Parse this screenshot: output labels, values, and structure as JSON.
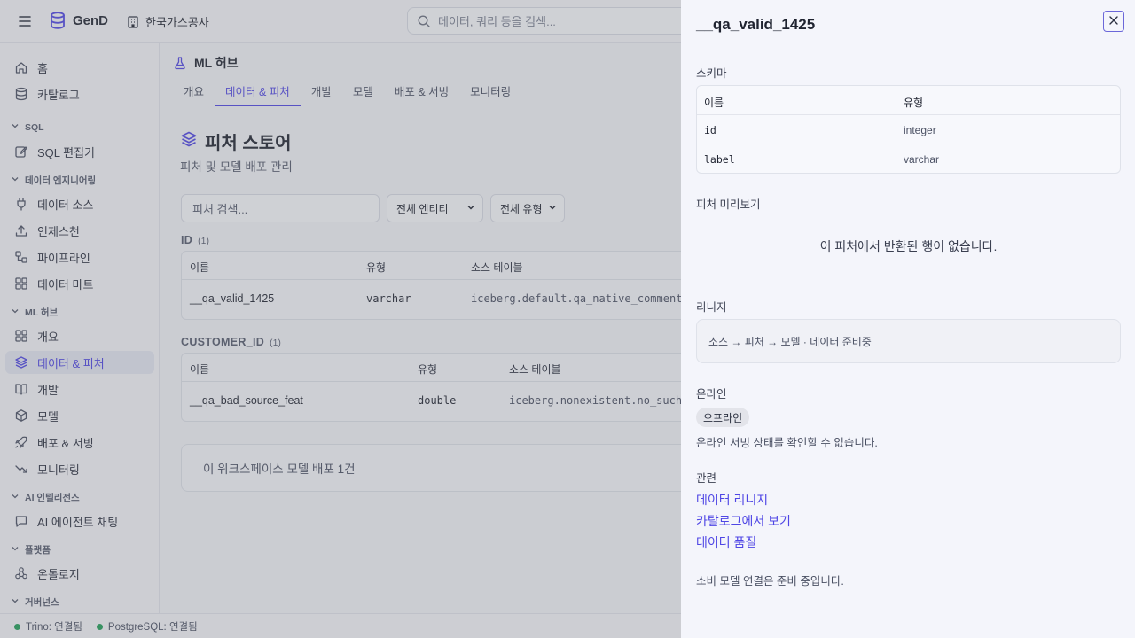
{
  "topbar": {
    "brand": "GenD",
    "org": "한국가스공사",
    "search_placeholder": "데이터, 쿼리 등을 검색..."
  },
  "sidebar": {
    "items_top": [
      {
        "label": "홈",
        "icon": "home-icon"
      },
      {
        "label": "카탈로그",
        "icon": "database-icon"
      }
    ],
    "sections": {
      "sql": "SQL",
      "data_eng": "데이터 엔지니어링",
      "ml_hub": "ML 허브",
      "ai": "AI 인텔리전스",
      "platform": "플랫폼",
      "governance": "거버넌스"
    },
    "sql_items": [
      {
        "label": "SQL 편집기",
        "icon": "edit-icon"
      }
    ],
    "de_items": [
      {
        "label": "데이터 소스",
        "icon": "plug-icon"
      },
      {
        "label": "인제스천",
        "icon": "upload-icon"
      },
      {
        "label": "파이프라인",
        "icon": "pipeline-icon"
      },
      {
        "label": "데이터 마트",
        "icon": "grid-icon"
      }
    ],
    "ml_items": [
      {
        "label": "개요",
        "icon": "grid-icon"
      },
      {
        "label": "데이터 & 피처",
        "icon": "layers-icon",
        "active": true
      },
      {
        "label": "개발",
        "icon": "book-icon"
      },
      {
        "label": "모델",
        "icon": "cube-icon"
      },
      {
        "label": "배포 & 서빙",
        "icon": "rocket-icon"
      },
      {
        "label": "모니터링",
        "icon": "trend-icon"
      }
    ],
    "ai_items": [
      {
        "label": "AI 에이전트 채팅",
        "icon": "chat-icon"
      }
    ],
    "platform_items": [
      {
        "label": "온톨로지",
        "icon": "network-icon"
      }
    ]
  },
  "statusbar": {
    "trino": "Trino: 연결됨",
    "postgres": "PostgreSQL: 연결됨"
  },
  "main": {
    "hub_title": "ML 허브",
    "tabs": [
      "개요",
      "데이터 & 피처",
      "개발",
      "모델",
      "배포 & 서빙",
      "모니터링"
    ],
    "active_tab": 1,
    "page_title": "피처 스토어",
    "page_subtitle": "피처 및 모델 배포 관리",
    "feature_search_placeholder": "피처 검색...",
    "entity_filter": "전체 엔티티",
    "type_filter": "전체 유형",
    "groups": [
      {
        "name": "ID",
        "count": "(1)",
        "headers": [
          "이름",
          "유형",
          "소스 테이블"
        ],
        "rows": [
          [
            "__qa_valid_1425",
            "varchar",
            "iceberg.default.qa_native_comment"
          ]
        ]
      },
      {
        "name": "CUSTOMER_ID",
        "count": "(1)",
        "headers": [
          "이름",
          "유형",
          "소스 테이블"
        ],
        "rows": [
          [
            "__qa_bad_source_feat",
            "double",
            "iceberg.nonexistent.no_such"
          ]
        ]
      }
    ],
    "deploy_card": "이 워크스페이스 모델 배포 1건"
  },
  "panel": {
    "title": "__qa_valid_1425",
    "schema_label": "스키마",
    "schema_headers": [
      "이름",
      "유형"
    ],
    "schema_rows": [
      [
        "id",
        "integer"
      ],
      [
        "label",
        "varchar"
      ]
    ],
    "preview_label": "피처 미리보기",
    "preview_empty": "이 피처에서 반환된 행이 없습니다.",
    "lineage_label": "리니지",
    "lineage_text": "소스 → 피처 → 모델 · 데이터 준비중",
    "online_label": "온라인",
    "online_badge": "오프라인",
    "online_text": "온라인 서빙 상태를 확인할 수 없습니다.",
    "related_label": "관련",
    "related_links": [
      "데이터 리니지",
      "카탈로그에서 보기",
      "데이터 품질"
    ],
    "consumer_text": "소비 모델 연결은 준비 중입니다."
  },
  "colors": {
    "accent": "#4f46e5",
    "status_ok": "#22a05a"
  }
}
